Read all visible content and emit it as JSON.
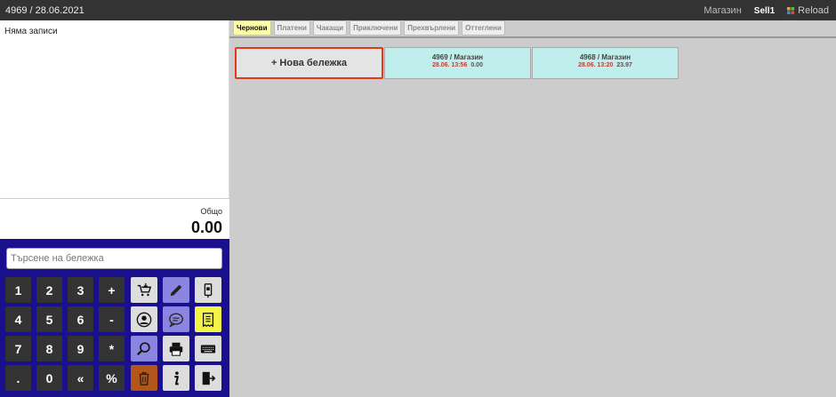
{
  "topbar": {
    "doc": "4969 / 28.06.2021",
    "store": "Магазин",
    "sell": "Sell1",
    "reload": "Reload"
  },
  "receipt": {
    "empty": "Няма записи",
    "total_label": "Общо",
    "total_value": "0.00"
  },
  "search": {
    "placeholder": "Търсене на бележка"
  },
  "keypad": {
    "keys": [
      "1",
      "2",
      "3",
      "+",
      "4",
      "5",
      "6",
      "-",
      "7",
      "8",
      "9",
      "*",
      ".",
      "0",
      "«",
      "%"
    ]
  },
  "tabs": [
    {
      "label": "Чернови"
    },
    {
      "label": "Платени"
    },
    {
      "label": "Чакащи"
    },
    {
      "label": "Приключени"
    },
    {
      "label": "Прехвърлени"
    },
    {
      "label": "Оттеглени"
    }
  ],
  "new_note": "+ Нова бележка",
  "receipts": [
    {
      "title": "4969 / Магазин",
      "datetime": "28.06. 13:56",
      "amount": "0.00"
    },
    {
      "title": "4968 / Магазин",
      "datetime": "28.06. 13:20",
      "amount": "23.97"
    }
  ],
  "colors": {
    "accent_tab": "#ffffaa",
    "keypad_bg": "#1a0f8c",
    "card_bg": "#bfeeed",
    "new_note_border": "#e03a1a"
  },
  "icons": [
    "cart-add-icon",
    "pencil-icon",
    "scan-card-icon",
    "user-icon",
    "comment-icon",
    "receipt-icon",
    "search-zoom-icon",
    "printer-icon",
    "keyboard-icon",
    "trash-icon",
    "info-icon",
    "exit-icon",
    "reload-icon"
  ]
}
